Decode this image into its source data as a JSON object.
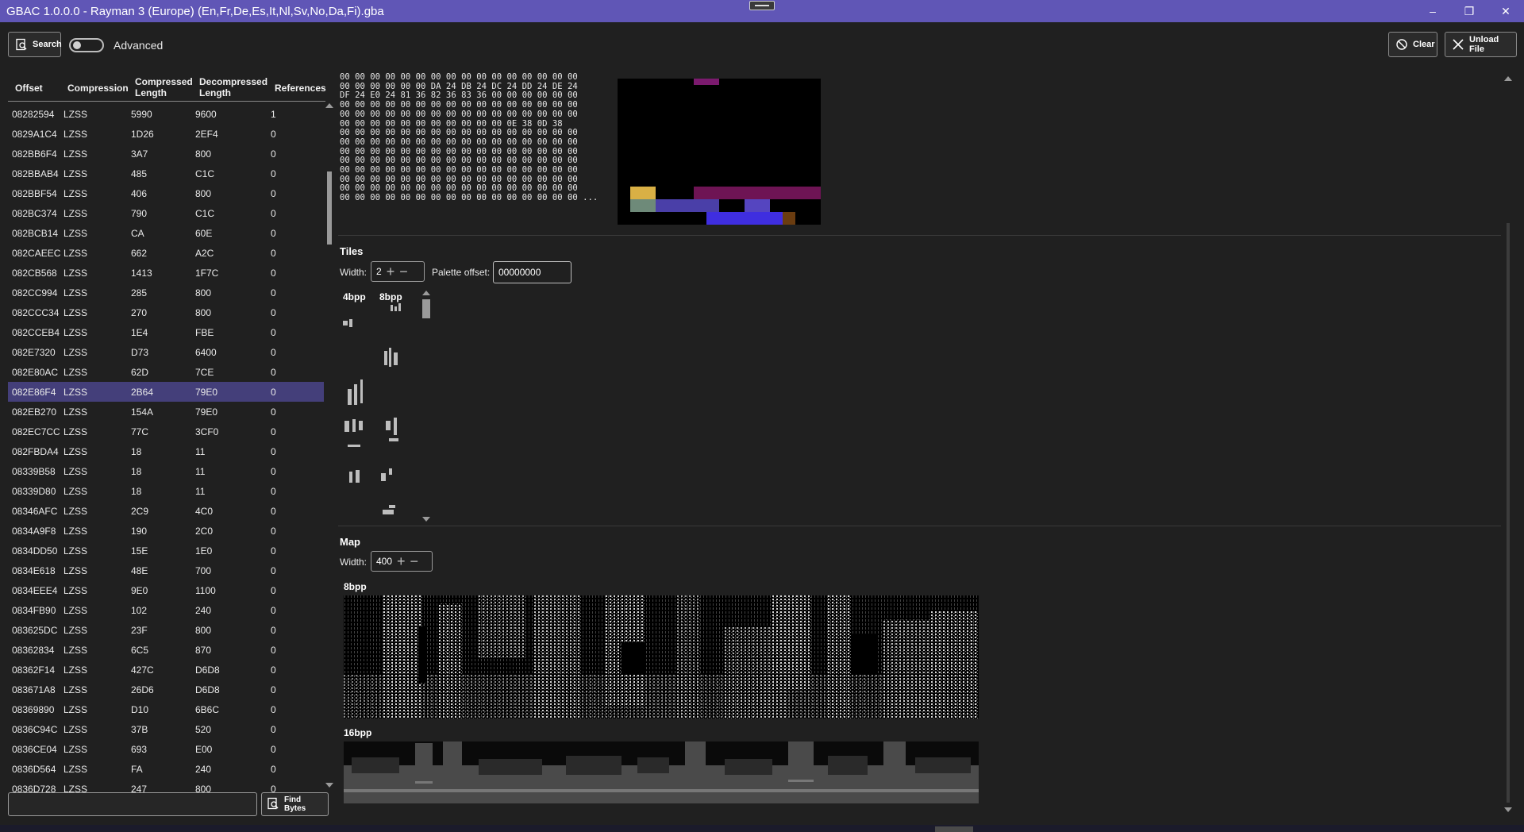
{
  "window": {
    "title": "GBAC 1.0.0.0 - Rayman 3 (Europe) (En,Fr,De,Es,It,Nl,Sv,No,Da,Fi).gba",
    "minimize": "–",
    "maximize": "❐",
    "close": "✕"
  },
  "toolbar": {
    "search_label": "Search",
    "advanced_label": "Advanced",
    "advanced_on": false,
    "clear_label": "Clear",
    "unload_label": "Unload File"
  },
  "table": {
    "headers": {
      "offset": "Offset",
      "compression": "Compression",
      "compressed_1": "Compressed",
      "compressed_2": "Length",
      "decompressed_1": "Decompressed",
      "decompressed_2": "Length",
      "references": "References"
    },
    "selected_row": 14,
    "rows": [
      [
        "08282594",
        "LZSS",
        "5990",
        "9600",
        "1"
      ],
      [
        "0829A1C4",
        "LZSS",
        "1D26",
        "2EF4",
        "0"
      ],
      [
        "082BB6F4",
        "LZSS",
        "3A7",
        "800",
        "0"
      ],
      [
        "082BBAB4",
        "LZSS",
        "485",
        "C1C",
        "0"
      ],
      [
        "082BBF54",
        "LZSS",
        "406",
        "800",
        "0"
      ],
      [
        "082BC374",
        "LZSS",
        "790",
        "C1C",
        "0"
      ],
      [
        "082BCB14",
        "LZSS",
        "CA",
        "60E",
        "0"
      ],
      [
        "082CAEEC",
        "LZSS",
        "662",
        "A2C",
        "0"
      ],
      [
        "082CB568",
        "LZSS",
        "1413",
        "1F7C",
        "0"
      ],
      [
        "082CC994",
        "LZSS",
        "285",
        "800",
        "0"
      ],
      [
        "082CCC34",
        "LZSS",
        "270",
        "800",
        "0"
      ],
      [
        "082CCEB4",
        "LZSS",
        "1E4",
        "FBE",
        "0"
      ],
      [
        "082E7320",
        "LZSS",
        "D73",
        "6400",
        "0"
      ],
      [
        "082E80AC",
        "LZSS",
        "62D",
        "7CE",
        "0"
      ],
      [
        "082E86F4",
        "LZSS",
        "2B64",
        "79E0",
        "0"
      ],
      [
        "082EB270",
        "LZSS",
        "154A",
        "79E0",
        "0"
      ],
      [
        "082EC7CC",
        "LZSS",
        "77C",
        "3CF0",
        "0"
      ],
      [
        "082FBDA4",
        "LZSS",
        "18",
        "11",
        "0"
      ],
      [
        "08339B58",
        "LZSS",
        "18",
        "11",
        "0"
      ],
      [
        "08339D80",
        "LZSS",
        "18",
        "11",
        "0"
      ],
      [
        "08346AFC",
        "LZSS",
        "2C9",
        "4C0",
        "0"
      ],
      [
        "0834A9F8",
        "LZSS",
        "190",
        "2C0",
        "0"
      ],
      [
        "0834DD50",
        "LZSS",
        "15E",
        "1E0",
        "0"
      ],
      [
        "0834E618",
        "LZSS",
        "48E",
        "700",
        "0"
      ],
      [
        "0834EEE4",
        "LZSS",
        "9E0",
        "1100",
        "0"
      ],
      [
        "0834FB90",
        "LZSS",
        "102",
        "240",
        "0"
      ],
      [
        "083625DC",
        "LZSS",
        "23F",
        "800",
        "0"
      ],
      [
        "08362834",
        "LZSS",
        "6C5",
        "870",
        "0"
      ],
      [
        "08362F14",
        "LZSS",
        "427C",
        "D6D8",
        "0"
      ],
      [
        "083671A8",
        "LZSS",
        "26D6",
        "D6D8",
        "0"
      ],
      [
        "08369890",
        "LZSS",
        "D10",
        "6B6C",
        "0"
      ],
      [
        "0836C94C",
        "LZSS",
        "37B",
        "520",
        "0"
      ],
      [
        "0836CE04",
        "LZSS",
        "693",
        "E00",
        "0"
      ],
      [
        "0836D564",
        "LZSS",
        "FA",
        "240",
        "0"
      ],
      [
        "0836D728",
        "LZSS",
        "247",
        "800",
        "0"
      ]
    ]
  },
  "find": {
    "value": "",
    "button_label": "Find Bytes"
  },
  "hex": {
    "lines": [
      "00 00 00 00 00 00 00 00 00 00 00 00 00 00 00 00",
      "00 00 00 00 00 00 DA 24 DB 24 DC 24 DD 24 DE 24",
      "DF 24 E0 24 81 36 82 36 83 36 00 00 00 00 00 00",
      "00 00 00 00 00 00 00 00 00 00 00 00 00 00 00 00",
      "00 00 00 00 00 00 00 00 00 00 00 00 00 00 00 00",
      "00 00 00 00 00 00 00 00 00 00 00 0E 38 0D 38",
      "00 00 00 00 00 00 00 00 00 00 00 00 00 00 00 00",
      "00 00 00 00 00 00 00 00 00 00 00 00 00 00 00 00",
      "00 00 00 00 00 00 00 00 00 00 00 00 00 00 00 00",
      "00 00 00 00 00 00 00 00 00 00 00 00 00 00 00 00",
      "00 00 00 00 00 00 00 00 00 00 00 00 00 00 00 00",
      "00 00 00 00 00 00 00 00 00 00 00 00 00 00 00 00",
      "00 00 00 00 00 00 00 00 00 00 00 00 00 00 00 00",
      "00 00 00 00 00 00 00 00 00 00 00 00 00 00 00 00 ..."
    ]
  },
  "tiles": {
    "title": "Tiles",
    "width_label": "Width:",
    "width_value": "2",
    "palette_label": "Palette offset:",
    "palette_value": "00000000",
    "col_4bpp": "4bpp",
    "col_8bpp": "8bpp"
  },
  "map": {
    "title": "Map",
    "width_label": "Width:",
    "width_value": "400",
    "label_8bpp": "8bpp",
    "label_16bpp": "16bpp"
  },
  "colors": {
    "titlebar": "#6056b6",
    "selection": "#443f7a",
    "background": "#202020"
  }
}
